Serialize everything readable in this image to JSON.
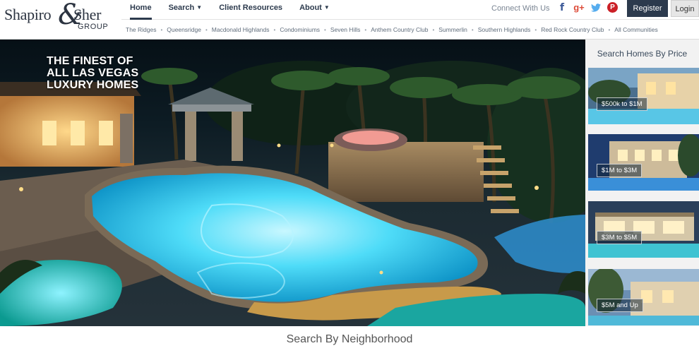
{
  "brand": {
    "logo_word_1": "Shapiro",
    "logo_ampersand": "&",
    "logo_word_2": "Sher",
    "logo_group": "GROUP"
  },
  "menu": {
    "items": [
      {
        "label": "Home",
        "active": true
      },
      {
        "label": "Search"
      },
      {
        "label": "Client Resources"
      },
      {
        "label": "About"
      }
    ]
  },
  "header_right": {
    "connect_label": "Connect With Us",
    "social_icons": [
      "facebook-icon",
      "google-plus-icon",
      "twitter-icon",
      "pinterest-icon"
    ],
    "register_label": "Register",
    "login_label": "Login"
  },
  "communities": [
    "The Ridges",
    "Queensridge",
    "Macdonald Highlands",
    "Condominiums",
    "Seven Hills",
    "Anthem Country Club",
    "Summerlin",
    "Southern Highlands",
    "Red Rock Country Club",
    "All Communities"
  ],
  "hero": {
    "headline": "THE FINEST OF\nALL LAS VEGAS\nLUXURY HOMES"
  },
  "price_search": {
    "title": "Search Homes By Price",
    "tiles": [
      {
        "label": "$500k to $1M"
      },
      {
        "label": "$1M to $3M"
      },
      {
        "label": "$3M to $5M"
      },
      {
        "label": "$5M and Up"
      }
    ]
  },
  "neighborhood_heading": "Search By Neighborhood",
  "colors": {
    "navy": "#2c3a4d",
    "pool": "#3fd3f5",
    "facebook": "#3b5998",
    "google_plus": "#dd4b39",
    "twitter": "#55acee",
    "pinterest": "#cb2027"
  }
}
